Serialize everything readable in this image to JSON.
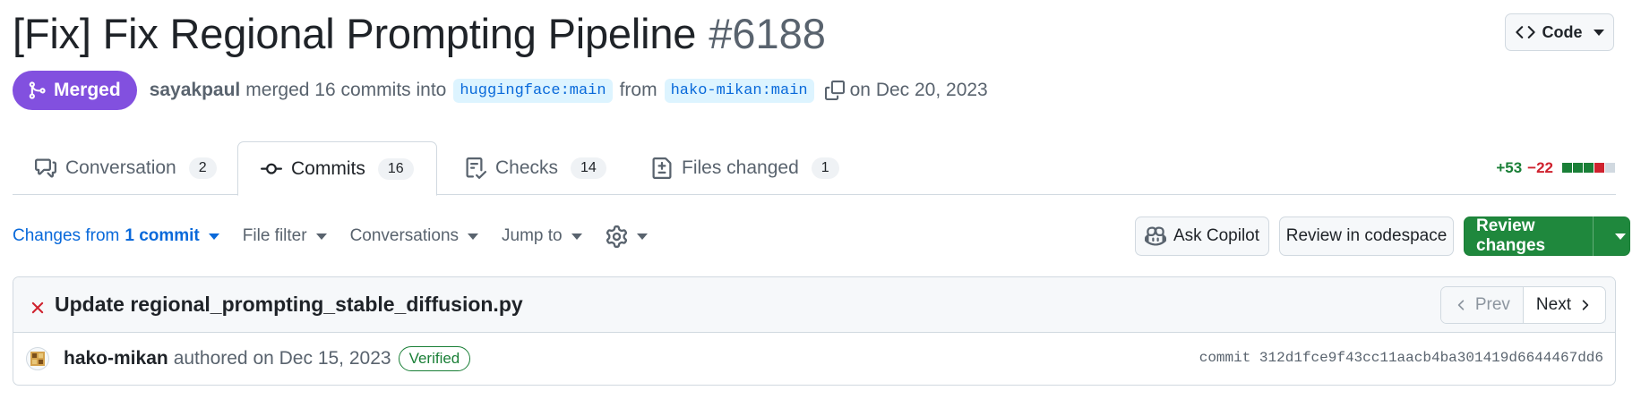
{
  "header": {
    "title": "[Fix] Fix Regional Prompting Pipeline",
    "number": "#6188",
    "code_button": "Code"
  },
  "meta": {
    "status": "Merged",
    "author": "sayakpaul",
    "action": "merged 16 commits into",
    "base_branch": "huggingface:main",
    "from_word": "from",
    "head_branch": "hako-mikan:main",
    "date": "on Dec 20, 2023"
  },
  "tabs": [
    {
      "label": "Conversation",
      "count": "2",
      "icon": "comment-discussion-icon"
    },
    {
      "label": "Commits",
      "count": "16",
      "icon": "git-commit-icon"
    },
    {
      "label": "Checks",
      "count": "14",
      "icon": "checklist-icon"
    },
    {
      "label": "Files changed",
      "count": "1",
      "icon": "file-diff-icon"
    }
  ],
  "diffstat": {
    "additions": "+53",
    "deletions": "−22",
    "colors": {
      "add": "#1a7f37",
      "del": "#cf222e",
      "neutral": "#d1d9e0"
    }
  },
  "toolbar": {
    "changes_from_prefix": "Changes from",
    "changes_from_value": "1 commit",
    "file_filter": "File filter",
    "conversations": "Conversations",
    "jump_to": "Jump to"
  },
  "actions": {
    "ask_copilot": "Ask Copilot",
    "review_codespace": "Review in codespace",
    "review_changes": "Review changes"
  },
  "commit": {
    "title": "Update regional_prompting_stable_diffusion.py",
    "status_icon": "x-icon",
    "prev": "Prev",
    "next": "Next",
    "author": "hako-mikan",
    "authored": "authored on Dec 15, 2023",
    "verified": "Verified",
    "sha": "commit 312d1fce9f43cc11aacb4ba301419d6644467dd6"
  },
  "colors": {
    "merged": "#8250df",
    "link": "#0969da",
    "primary": "#1f883d",
    "error": "#cf222e"
  }
}
